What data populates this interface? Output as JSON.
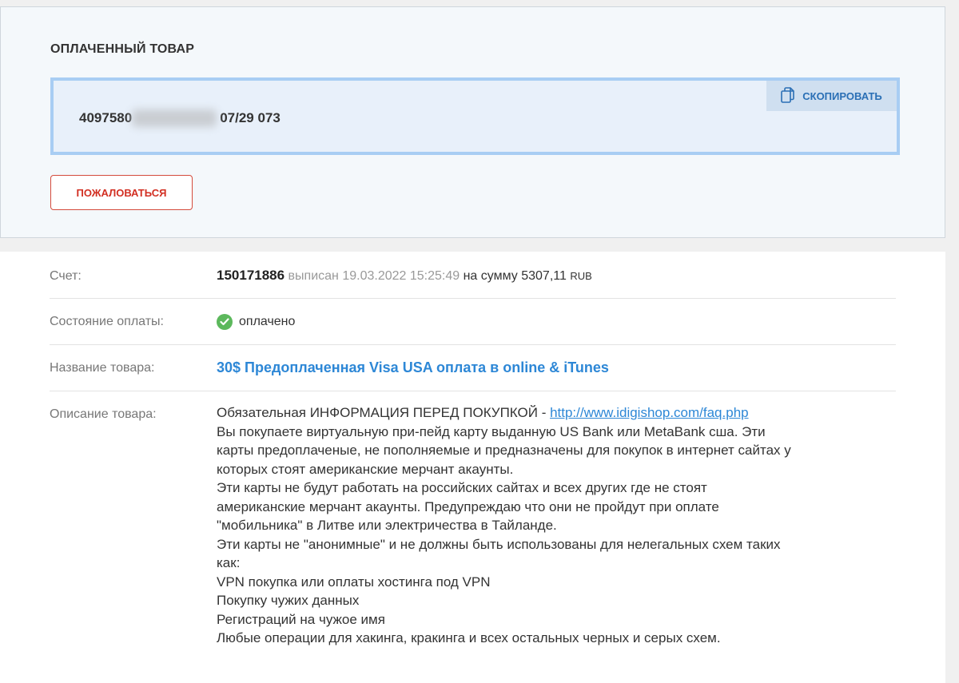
{
  "paid": {
    "title": "ОПЛАЧЕННЫЙ ТОВАР",
    "product_prefix": "4097580",
    "product_suffix": "07/29 073",
    "copy_label": "СКОПИРОВАТЬ",
    "complain_label": "ПОЖАЛОВАТЬСЯ"
  },
  "invoice": {
    "label": "Счет:",
    "number": "150171886",
    "issued_text": "выписан 19.03.2022 15:25:49",
    "amount_text": "на сумму 5307,11",
    "currency": "RUB"
  },
  "payment": {
    "label": "Состояние оплаты:",
    "status": "оплачено"
  },
  "product": {
    "label": "Название товара:",
    "name": "30$ Предоплаченная Visa USA оплата в online & iTunes"
  },
  "description": {
    "label": "Описание товара:",
    "intro": "Обязательная ИНФОРМАЦИЯ ПЕРЕД ПОКУПКОЙ - ",
    "link": "http://www.idigishop.com/faq.php",
    "lines": [
      "Вы покупаете виртуальную при-пейд карту выданную US Bank или MetaBank сша. Эти",
      "карты предоплаченые, не пополняемые и предназначены для покупок в интернет сайтах у",
      "которых стоят американские мерчант акаунты.",
      "Эти карты не будут работать на российских сайтах и всех других где не стоят",
      "американские мерчант акаунты. Предупреждаю что они не пройдут при оплате",
      "\"мобильника\" в Литве или электричества в Тайланде.",
      "Эти карты не \"анонимные\" и не должны быть использованы для нелегальных схем таких",
      "как:",
      "VPN покупка или оплаты хостинга под VPN",
      "Покупку чужих данных",
      "Регистраций на чужое имя",
      "Любые операции для хакинга, кракинга и всех остальных черных и серых схем."
    ]
  },
  "colors": {
    "accent": "#2d87d6",
    "danger": "#d22f22",
    "success": "#5cb85c"
  }
}
